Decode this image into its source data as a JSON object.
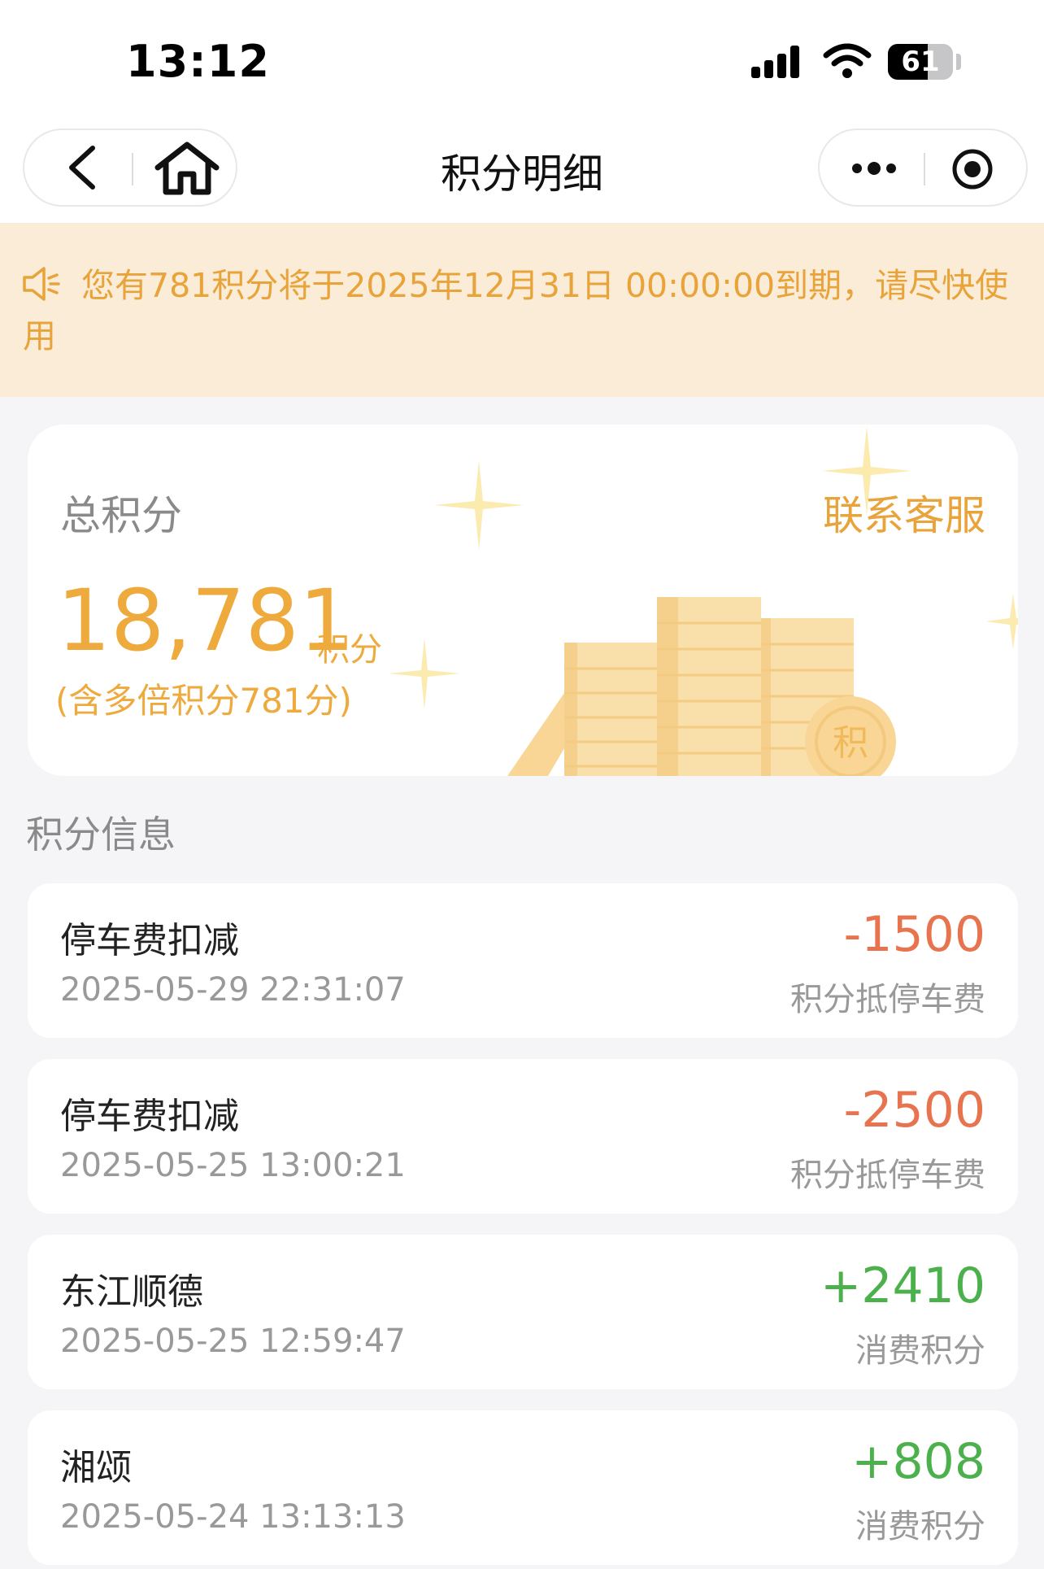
{
  "status_bar": {
    "time": "13:12",
    "battery": "61",
    "battery_level": 0.61
  },
  "navbar": {
    "title": "积分明细"
  },
  "notice": {
    "text": "您有781积分将于2025年12月31日 00:00:00到期，请尽快使用"
  },
  "summary": {
    "total_label": "总积分",
    "contact_label": "联系客服",
    "total_value": "18,781",
    "unit": "积分",
    "note": "(含多倍积分781分)",
    "coin_char": "积"
  },
  "section_title": "积分信息",
  "records": [
    {
      "title": "停车费扣减",
      "time": "2025-05-29 22:31:07",
      "amount": "-1500",
      "type": "积分抵停车费",
      "sign": "neg"
    },
    {
      "title": "停车费扣减",
      "time": "2025-05-25 13:00:21",
      "amount": "-2500",
      "type": "积分抵停车费",
      "sign": "neg"
    },
    {
      "title": "东江顺德",
      "time": "2025-05-25 12:59:47",
      "amount": "+2410",
      "type": "消费积分",
      "sign": "pos"
    },
    {
      "title": "湘颂",
      "time": "2025-05-24 13:13:13",
      "amount": "+808",
      "type": "消费积分",
      "sign": "pos"
    }
  ],
  "colors": {
    "accent": "#eeaa3c",
    "notice_bg": "#faecd6",
    "negative": "#e8744f",
    "positive": "#4cb14c"
  }
}
